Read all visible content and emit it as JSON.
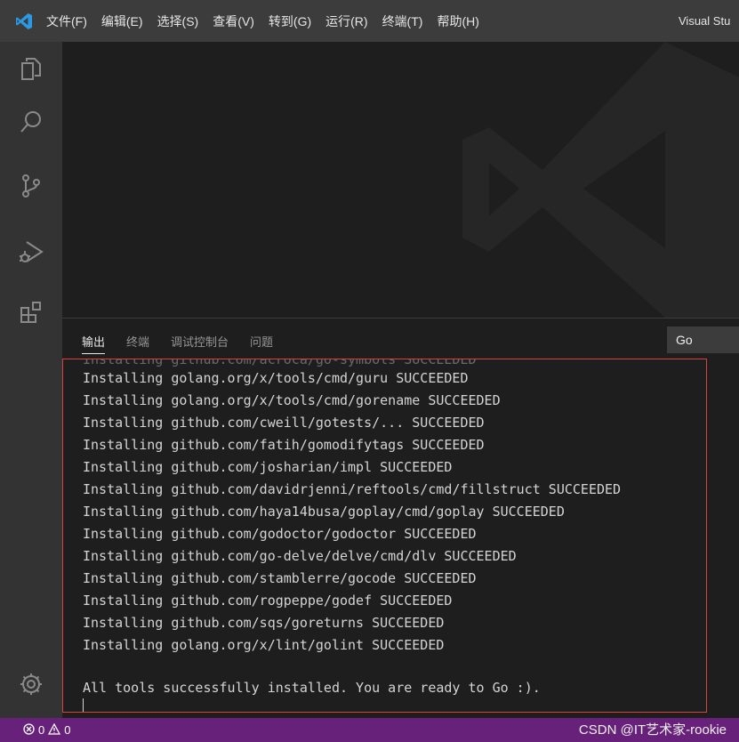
{
  "titlebar": {
    "menu": [
      "文件(F)",
      "编辑(E)",
      "选择(S)",
      "查看(V)",
      "转到(G)",
      "运行(R)",
      "终端(T)",
      "帮助(H)"
    ],
    "window_title": "Visual Stu"
  },
  "activitybar": {
    "icons": [
      "explorer-icon",
      "search-icon",
      "source-control-icon",
      "run-debug-icon",
      "extensions-icon"
    ],
    "bottom_icon": "settings-gear-icon"
  },
  "panel": {
    "tabs": [
      "输出",
      "终端",
      "调试控制台",
      "问题"
    ],
    "active_tab": "输出",
    "channel": "Go",
    "output_lines": [
      "Installing golang.org/x/tools/cmd/guru SUCCEEDED",
      "Installing golang.org/x/tools/cmd/gorename SUCCEEDED",
      "Installing github.com/cweill/gotests/... SUCCEEDED",
      "Installing github.com/fatih/gomodifytags SUCCEEDED",
      "Installing github.com/josharian/impl SUCCEEDED",
      "Installing github.com/davidrjenni/reftools/cmd/fillstruct SUCCEEDED",
      "Installing github.com/haya14busa/goplay/cmd/goplay SUCCEEDED",
      "Installing github.com/godoctor/godoctor SUCCEEDED",
      "Installing github.com/go-delve/delve/cmd/dlv SUCCEEDED",
      "Installing github.com/stamblerre/gocode SUCCEEDED",
      "Installing github.com/rogpeppe/godef SUCCEEDED",
      "Installing github.com/sqs/goreturns SUCCEEDED",
      "Installing golang.org/x/lint/golint SUCCEEDED",
      "",
      "All tools successfully installed. You are ready to Go :)."
    ],
    "highlight_color": "#d9423b"
  },
  "statusbar": {
    "errors": "0",
    "warnings": "0",
    "color": "#68217a"
  },
  "watermark": "CSDN @IT艺术家-rookie"
}
